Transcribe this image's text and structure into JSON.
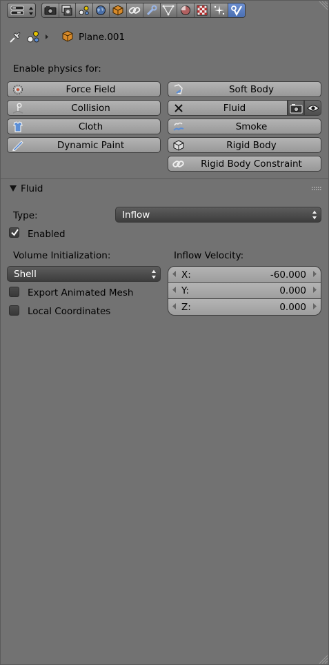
{
  "context": {
    "object_name": "Plane.001"
  },
  "physics": {
    "heading": "Enable physics for:",
    "left": [
      "Force Field",
      "Collision",
      "Cloth",
      "Dynamic Paint"
    ],
    "right": [
      "Soft Body",
      "Fluid",
      "Smoke",
      "Rigid Body",
      "Rigid Body Constraint"
    ]
  },
  "fluid_panel": {
    "title": "Fluid",
    "type_label": "Type:",
    "type_value": "Inflow",
    "enabled_label": "Enabled",
    "enabled_checked": true,
    "volume_label": "Volume Initialization:",
    "volume_value": "Shell",
    "export_label": "Export Animated Mesh",
    "export_checked": false,
    "local_label": "Local Coordinates",
    "local_checked": false,
    "velocity_label": "Inflow Velocity:",
    "velocity": [
      {
        "axis": "X:",
        "value": "-60.000"
      },
      {
        "axis": "Y:",
        "value": "0.000"
      },
      {
        "axis": "Z:",
        "value": "0.000"
      }
    ]
  },
  "colors": {
    "panel_bg": "#727272",
    "active_tab": "#5a7fc4",
    "button": "#a6a6a6",
    "dark_field": "#4a4a4a"
  },
  "icons": {
    "tabs": [
      "render-icon",
      "render-layers-icon",
      "scene-icon",
      "world-icon",
      "object-icon",
      "constraints-icon",
      "modifiers-icon",
      "data-icon",
      "material-icon",
      "texture-icon",
      "particles-icon",
      "physics-icon"
    ]
  }
}
